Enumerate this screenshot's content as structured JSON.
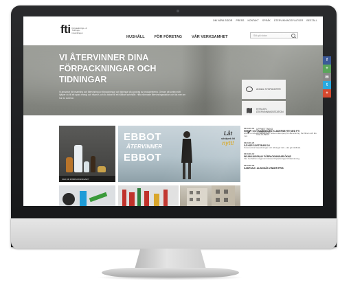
{
  "top_nav": [
    "Om Våra Sidor",
    "Press",
    "Kontakt",
    "Språk",
    "Återvinningsplatser",
    "Beställ"
  ],
  "logo": {
    "mark": "fti",
    "subtitle": "Förpacknings- & Tidnings­insamlingen"
  },
  "main_nav": [
    "HUSHÅLL",
    "FÖR FÖRETAG",
    "VÅR VERKSAMHET"
  ],
  "search": {
    "placeholder": "Sök på sidan"
  },
  "hero": {
    "title": "VI ÅTERVINNER DINA FÖRPACKNINGAR OCH TIDNINGAR",
    "description": "Vi ansvarar för insamling och återvinning av förpackningar och tidningar på uppdrag av producenterna. Genom att sortera rätt hjälper du till att spara energi och råvaror, och du bidrar till ett hållbart samhälle. Hitta närmaste återvinningsstation och läs mer om hur du sorterar."
  },
  "side_buttons": [
    {
      "icon": "chat-bubble-icon",
      "label": "Anmäl synpunkter"
    },
    {
      "icon": "map-icon",
      "label": "Hitta en återvinningsstation"
    },
    {
      "icon": "check-icon",
      "label": "Upphettning tömning av stationer"
    }
  ],
  "social": [
    {
      "icon": "facebook-icon",
      "glyph": "f",
      "color": "#3b5998"
    },
    {
      "icon": "share-icon",
      "glyph": "+",
      "color": "#5aa55a"
    },
    {
      "icon": "email-icon",
      "glyph": "✉",
      "color": "#888888"
    },
    {
      "icon": "twitter-icon",
      "glyph": "t",
      "color": "#29a9e0"
    },
    {
      "icon": "google-plus-icon",
      "glyph": "+",
      "color": "#d6492f"
    }
  ],
  "tiles": {
    "products_caption": "Vad är förpackningar?",
    "ebbot": {
      "line1": "EBBOT",
      "line2": "ÅTERVINNER",
      "line3": "EBBOT",
      "logo_line1": "Låt",
      "logo_line2": "skräpet bli",
      "logo_line3": "nytt!"
    }
  },
  "news": [
    {
      "date": "2013-10-01",
      "headline": "Ebbot och kampanjen klädersbyte med fti",
      "text": "Ebbot Lundberg medverkar i höstens kampanj för återvinning. Se filmen och läs mer."
    },
    {
      "date": "2013-09-24",
      "headline": "Så här sorterar du",
      "text": "Sortera dina förpackningar och tidningar rätt – det gör skillnad."
    },
    {
      "date": "2013-09-12",
      "headline": "Insamlingen av förpackningar ökar",
      "text": "Fler hushåll än någonsin lämnar förpackningar till återvinning."
    },
    {
      "date": "2013-09-02",
      "headline": "Kampanj i Alingsås vinner pris",
      "text": ""
    }
  ]
}
